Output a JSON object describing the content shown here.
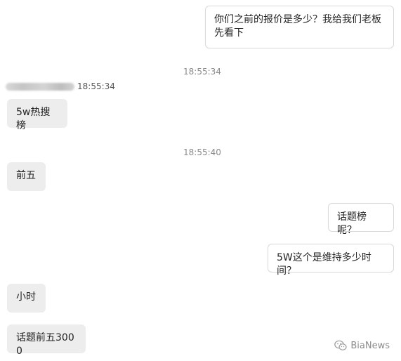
{
  "messages": [
    {
      "side": "right",
      "text": "你们之前的报价是多少？我给我们老板先看下"
    },
    {
      "side": "center",
      "time": "18:55:34"
    },
    {
      "side": "left",
      "sender_time": "18:55:34",
      "text": "5w热搜榜"
    },
    {
      "side": "center",
      "time": "18:55:40"
    },
    {
      "side": "left",
      "text": "前五"
    },
    {
      "side": "right",
      "text": "话题榜呢？"
    },
    {
      "side": "right",
      "text": "5W这个是维持多少时间？"
    },
    {
      "side": "left",
      "text": "小时"
    },
    {
      "side": "left",
      "text": "话题前五3000"
    }
  ],
  "watermark": {
    "text": "BiaNews",
    "icon": "wechat-icon"
  },
  "colors": {
    "left_bubble_bg": "#ededed",
    "right_bubble_bg": "#ffffff",
    "right_bubble_border": "#d9d9d9",
    "timestamp": "#8a8a8a"
  }
}
